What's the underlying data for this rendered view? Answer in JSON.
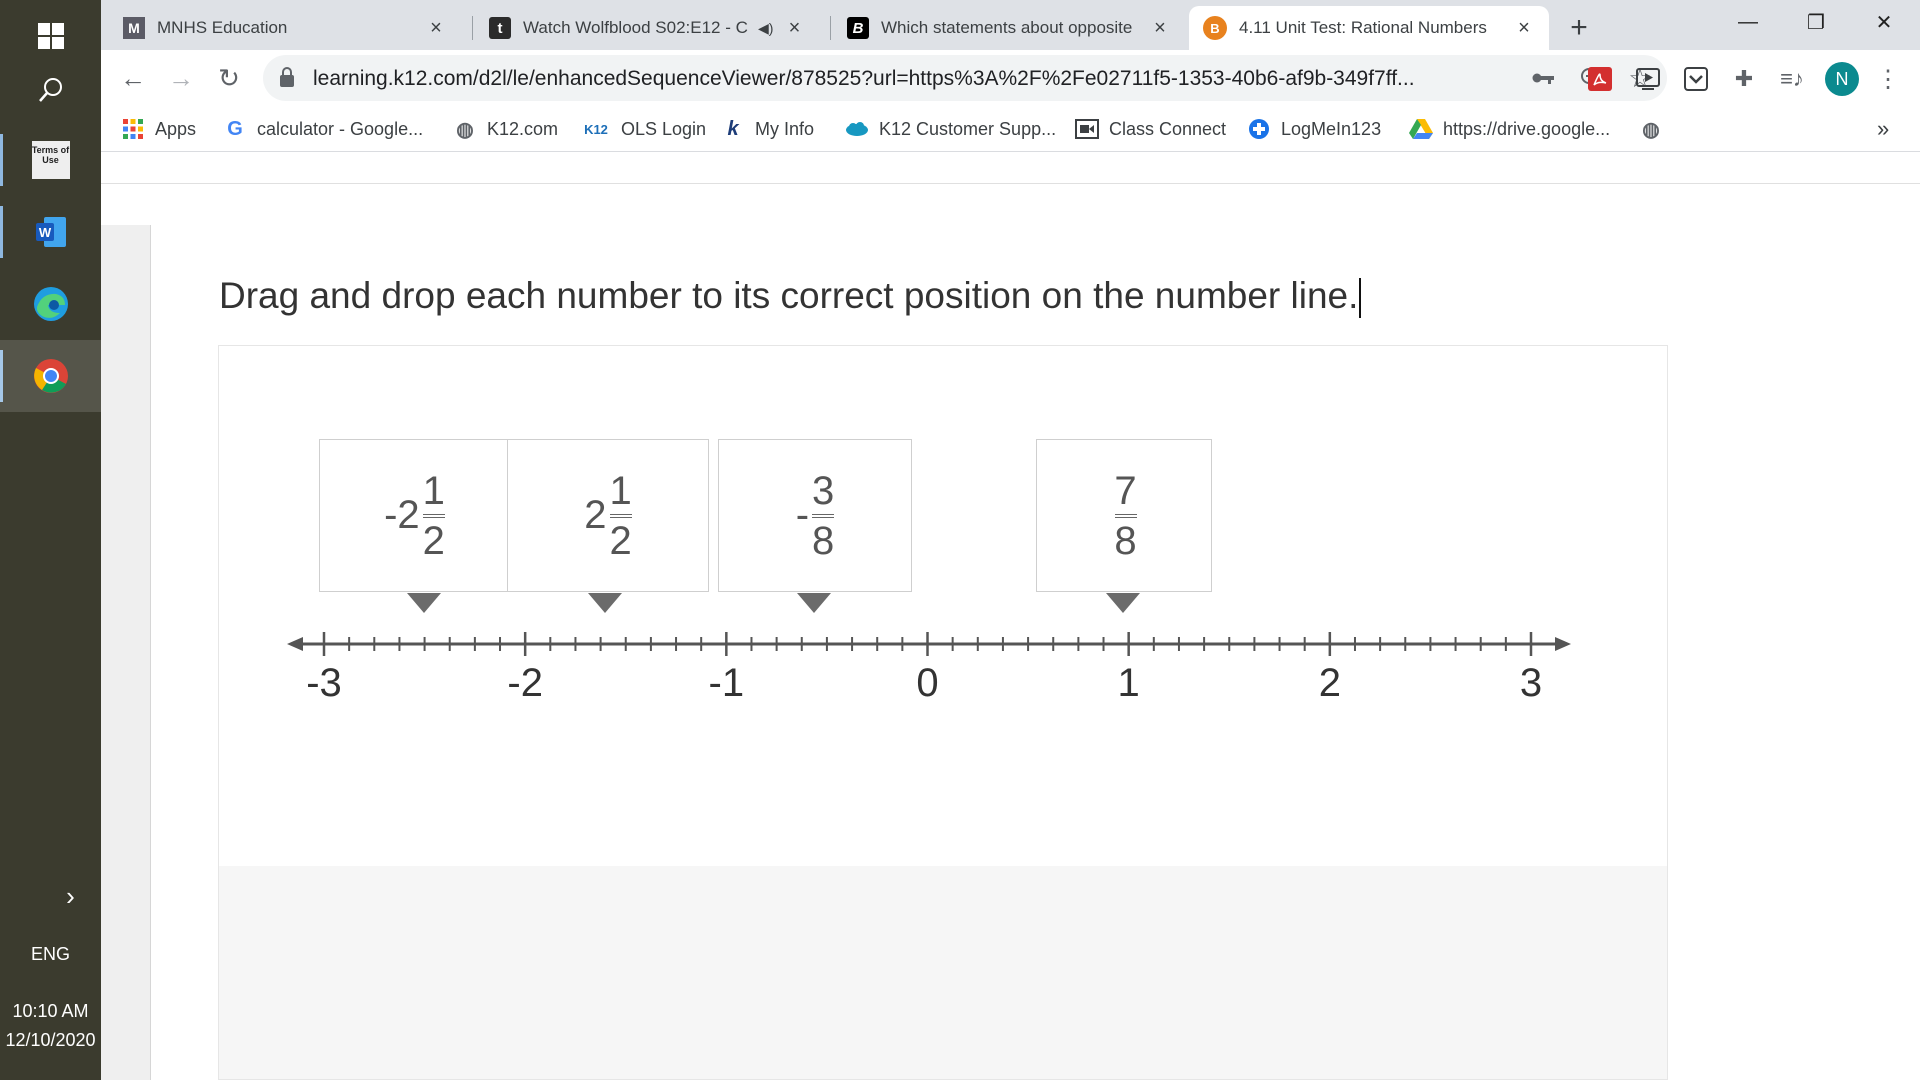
{
  "taskbar": {
    "language": "ENG",
    "time": "10:10 AM",
    "date": "12/10/2020",
    "terms_icon_text": "Terms of Use"
  },
  "tabs": [
    {
      "title": "MNHS Education",
      "icon": "mnhs-icon"
    },
    {
      "title": "Watch Wolfblood S02:E12 - C",
      "icon": "tumblr-icon"
    },
    {
      "title": "Which statements about opposite",
      "icon": "brainly-icon"
    },
    {
      "title": "4.11 Unit Test: Rational Numbers",
      "icon": "k12-icon",
      "active": true
    }
  ],
  "toolbar": {
    "url": "learning.k12.com/d2l/le/enhancedSequenceViewer/878525?url=https%3A%2F%2Fe02711f5-1353-40b6-af9b-349f7ff...",
    "profile_initial": "N"
  },
  "bookmarks": [
    {
      "label": "Apps",
      "icon": "apps-grid-icon"
    },
    {
      "label": "calculator - Google...",
      "icon": "google-icon"
    },
    {
      "label": "K12.com",
      "icon": "globe-icon"
    },
    {
      "label": "OLS Login",
      "icon": "k12-logo-icon"
    },
    {
      "label": "My Info",
      "icon": "k12-logo-icon"
    },
    {
      "label": "K12 Customer Supp...",
      "icon": "salesforce-icon"
    },
    {
      "label": "Class Connect",
      "icon": "video-icon"
    },
    {
      "label": "LogMeIn123",
      "icon": "logmein-icon"
    },
    {
      "label": "https://drive.google...",
      "icon": "drive-icon"
    },
    {
      "label": "",
      "icon": "globe-icon"
    }
  ],
  "question": {
    "prompt": "Drag and drop each number to its correct position on the number line."
  },
  "cards": [
    {
      "sign": "-",
      "whole": "2",
      "numerator": "1",
      "denominator": "2"
    },
    {
      "sign": "",
      "whole": "2",
      "numerator": "1",
      "denominator": "2"
    },
    {
      "sign": "-",
      "whole": "",
      "numerator": "3",
      "denominator": "8"
    },
    {
      "sign": "",
      "whole": "",
      "numerator": "7",
      "denominator": "8"
    }
  ],
  "number_line": {
    "min": -3,
    "max": 3,
    "labels": [
      "-3",
      "-2",
      "-1",
      "0",
      "1",
      "2",
      "3"
    ],
    "minor_ticks_per_unit": 8
  }
}
